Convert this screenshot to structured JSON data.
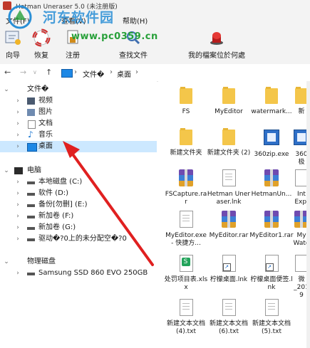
{
  "window": {
    "title": "Hetman Uneraser 5.0 (未注册版)"
  },
  "watermark": {
    "site_name": "河东软件园",
    "url": "www.pc0359.cn"
  },
  "menu": {
    "items": [
      "文件(F)",
      "查看(V)",
      "帮助(H)"
    ]
  },
  "toolbar": {
    "buttons": [
      {
        "label": "向导",
        "icon": "wizard-icon"
      },
      {
        "label": "恢复",
        "icon": "lifebuoy-icon"
      },
      {
        "label": "注册",
        "icon": "register-icon"
      },
      {
        "label": "查找文件",
        "icon": "find-icon"
      },
      {
        "label": "我的檔案位於何處",
        "icon": "red-button-icon"
      }
    ]
  },
  "address": {
    "crumbs": [
      "文件�",
      "桌面"
    ]
  },
  "tree": {
    "items": [
      {
        "label": "文件�",
        "level": 0,
        "expanded": true,
        "icon": "folder-icon"
      },
      {
        "label": "视频",
        "level": 1,
        "icon": "video-icon"
      },
      {
        "label": "图片",
        "level": 1,
        "icon": "pictures-icon"
      },
      {
        "label": "文档",
        "level": 1,
        "icon": "documents-icon"
      },
      {
        "label": "音乐",
        "level": 1,
        "icon": "music-icon"
      },
      {
        "label": "桌面",
        "level": 1,
        "icon": "desktop-icon",
        "selected": true
      },
      {
        "label": "电脑",
        "level": 0,
        "expanded": true,
        "icon": "computer-icon"
      },
      {
        "label": "本地磁盘 (C:)",
        "level": 1,
        "icon": "drive-icon"
      },
      {
        "label": "软件 (D:)",
        "level": 1,
        "icon": "drive-icon"
      },
      {
        "label": "备份[勿删] (E:)",
        "level": 1,
        "icon": "drive-icon"
      },
      {
        "label": "新加卷 (F:)",
        "level": 1,
        "icon": "drive-icon"
      },
      {
        "label": "新加卷 (G:)",
        "level": 1,
        "icon": "drive-icon"
      },
      {
        "label": "驱动�?0上的未分配空�?0",
        "level": 1,
        "icon": "drive-icon"
      },
      {
        "label": "物理磁盘",
        "level": 0,
        "expanded": true,
        "icon": ""
      },
      {
        "label": "Samsung SSD 860 EVO 250GB",
        "level": 1,
        "icon": "disk-icon"
      }
    ]
  },
  "files": [
    {
      "name": "FS",
      "type": "folder"
    },
    {
      "name": "MyEditor",
      "type": "folder"
    },
    {
      "name": "watermark...",
      "type": "folder"
    },
    {
      "name": "新建文件夹",
      "type": "folder"
    },
    {
      "name": "新建文件夹 (2)",
      "type": "folder"
    },
    {
      "name": "360zip.exe",
      "type": "exe"
    },
    {
      "name": "FSCapture.rar",
      "type": "rar"
    },
    {
      "name": "Hetman Uneraser.lnk",
      "type": "doc"
    },
    {
      "name": "HetmanUn...",
      "type": "rar"
    },
    {
      "name": "MyEditor.exe - 快捷方...",
      "type": "doc"
    },
    {
      "name": "MyEditor.rar",
      "type": "rar"
    },
    {
      "name": "MyEditor1.rar",
      "type": "rar"
    },
    {
      "name": "处罚项目表.xlsx",
      "type": "xlsx"
    },
    {
      "name": "柠檬桌面.lnk",
      "type": "lnk"
    },
    {
      "name": "柠檬桌面便签.lnk",
      "type": "lnk"
    },
    {
      "name": "新建文本文档 (4).txt",
      "type": "doc"
    },
    {
      "name": "新建文本文档 (6).txt",
      "type": "doc"
    },
    {
      "name": "新建文本文档 (5).txt",
      "type": "doc"
    }
  ],
  "files_partial_right": [
    "新",
    "360极",
    "Int",
    "Expl",
    "My",
    "Wate",
    "微",
    "_2019"
  ],
  "colors": {
    "accent": "#0078d7",
    "selection": "#cce8ff",
    "arrow": "#e02020"
  }
}
